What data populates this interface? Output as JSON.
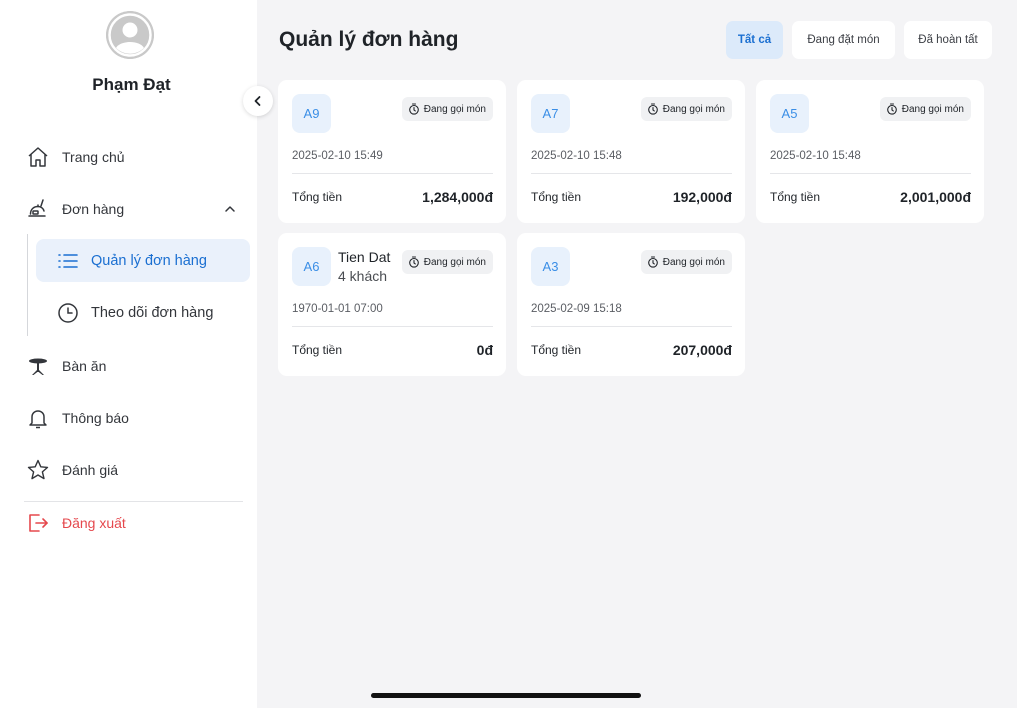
{
  "user": {
    "name": "Phạm Đạt"
  },
  "nav": {
    "home": "Trang chủ",
    "orders": "Đơn hàng",
    "orders_sub": {
      "manage": "Quản lý đơn hàng",
      "track": "Theo dõi đơn hàng"
    },
    "tables": "Bàn ăn",
    "notifications": "Thông báo",
    "reviews": "Đánh giá",
    "logout": "Đăng xuất"
  },
  "page": {
    "title": "Quản lý đơn hàng"
  },
  "filters": [
    "Tất cả",
    "Đang đặt món",
    "Đã hoàn tất"
  ],
  "filter_active": "Tất cả",
  "total_label": "Tổng tiền",
  "orders": [
    {
      "code": "A9",
      "status": "Đang gọi món",
      "datetime": "2025-02-10 15:49",
      "total": "1,284,000đ"
    },
    {
      "code": "A7",
      "status": "Đang gọi món",
      "datetime": "2025-02-10 15:48",
      "total": "192,000đ"
    },
    {
      "code": "A5",
      "status": "Đang gọi món",
      "datetime": "2025-02-10 15:48",
      "total": "2,001,000đ"
    },
    {
      "code": "A6",
      "guest_name": "Tien Dat",
      "guest_count": "4 khách",
      "status": "Đang gọi món",
      "datetime": "1970-01-01 07:00",
      "total": "0đ"
    },
    {
      "code": "A3",
      "status": "Đang gọi món",
      "datetime": "2025-02-09 15:18",
      "total": "207,000đ"
    }
  ],
  "colors": {
    "accent": "#1a6fd1",
    "active_bg": "#eaf1fb",
    "danger": "#e5484d",
    "background": "#f4f4f6"
  },
  "icons": {
    "home": "home-icon",
    "orders": "food-tray-icon",
    "manage": "list-icon",
    "track": "clock-icon",
    "tables": "dining-table-icon",
    "notifications": "bell-icon",
    "reviews": "star-icon",
    "logout": "logout-icon",
    "status": "timer-icon"
  }
}
